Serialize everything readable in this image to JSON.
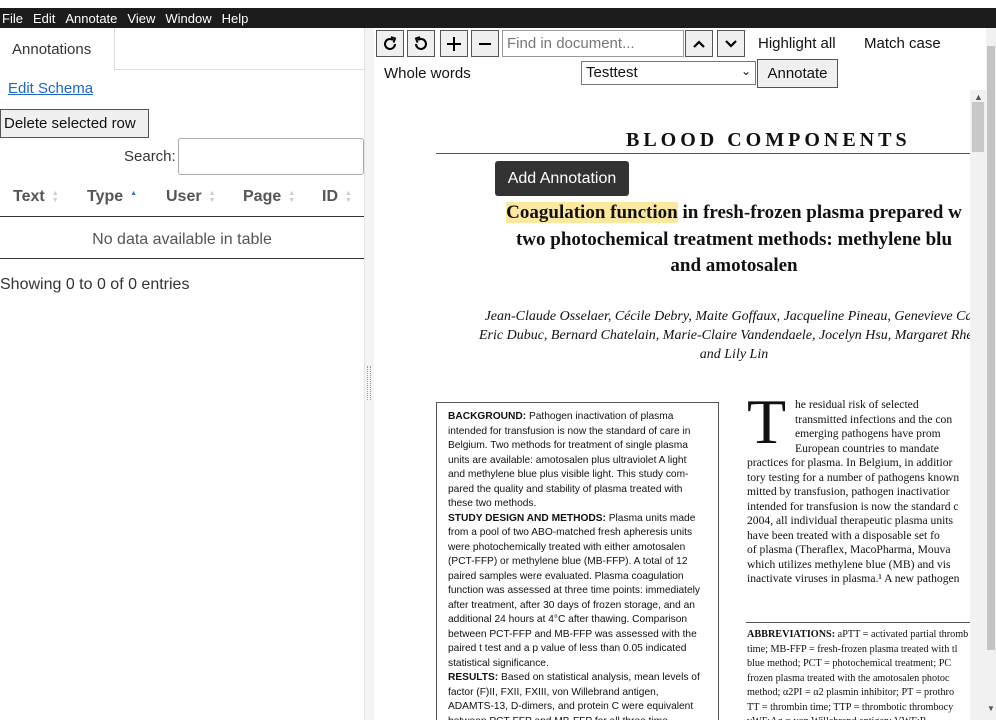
{
  "menu": [
    "File",
    "Edit",
    "Annotate",
    "View",
    "Window",
    "Help"
  ],
  "left": {
    "tab": "Annotations",
    "edit_schema": "Edit Schema",
    "delete_btn": "Delete selected row",
    "search_label": "Search:",
    "search_value": "",
    "columns": [
      "Text",
      "Type",
      "User",
      "Page",
      "ID"
    ],
    "sorted_column": "Type",
    "no_data": "No data available in table",
    "showing": "Showing 0 to 0 of 0 entries"
  },
  "toolbar": {
    "icons": [
      "redo-icon",
      "undo-icon",
      "zoom-in-icon",
      "zoom-out-icon",
      "find-previous-icon",
      "find-next-icon"
    ],
    "find_placeholder": "Find in document...",
    "highlight_all": "Highlight all",
    "match_case": "Match case",
    "whole_words": "Whole words",
    "schema_selected": "Testtest",
    "annotate": "Annotate"
  },
  "document": {
    "header": "BLOOD COMPONENTS",
    "add_annotation": "Add Annotation",
    "title_highlight": "Coagulation function",
    "title_line1_rest": " in fresh-frozen plasma prepared w",
    "title_line2": "two photochemical treatment methods: methylene blu",
    "title_line3": "and amotosalen",
    "authors": [
      "Jean-Claude Osselaer, Cécile Debry, Maite Goffaux, Jacqueline Pineau, Genevieve Calo",
      "Eric Dubuc, Bernard Chatelain, Marie-Claire Vandendaele, Jocelyn Hsu, Margaret Rheins",
      "and Lily Lin"
    ],
    "abstract": [
      {
        "h": "BACKGROUND:",
        "t": " Pathogen inactivation of plasma"
      },
      {
        "h": "",
        "t": "intended for transfusion is now the standard of care in"
      },
      {
        "h": "",
        "t": "Belgium. Two methods for treatment of single plasma"
      },
      {
        "h": "",
        "t": "units are available: amotosalen plus ultraviolet A light"
      },
      {
        "h": "",
        "t": "and methylene blue plus visible light. This study com-"
      },
      {
        "h": "",
        "t": "pared the quality and stability of plasma treated with"
      },
      {
        "h": "",
        "t": "these two methods."
      },
      {
        "h": "STUDY DESIGN AND METHODS:",
        "t": " Plasma units made"
      },
      {
        "h": "",
        "t": "from a pool of two ABO-matched fresh apheresis units"
      },
      {
        "h": "",
        "t": "were photochemically treated with either amotosalen"
      },
      {
        "h": "",
        "t": "(PCT-FFP) or methylene blue (MB-FFP). A total of 12"
      },
      {
        "h": "",
        "t": "paired samples were evaluated. Plasma coagulation"
      },
      {
        "h": "",
        "t": "function was assessed at three time points: immediately"
      },
      {
        "h": "",
        "t": "after treatment, after 30 days of frozen storage, and an"
      },
      {
        "h": "",
        "t": "additional 24 hours at 4°C after thawing. Comparison"
      },
      {
        "h": "",
        "t": "between PCT-FFP and MB-FFP was assessed with the"
      },
      {
        "h": "",
        "t": "paired t test and a p value of less than 0.05 indicated"
      },
      {
        "h": "",
        "t": "statistical significance."
      },
      {
        "h": "RESULTS:",
        "t": " Based on statistical analysis, mean levels of"
      },
      {
        "h": "",
        "t": "factor (F)II, FXII, FXIII, von Willebrand antigen,"
      },
      {
        "h": "",
        "t": "ADAMTS-13, D-dimers, and protein C were equivalent"
      },
      {
        "h": "",
        "t": "between PCT-FFP and MB-FFP for all three time"
      }
    ],
    "dropcap": "T",
    "body_indented": [
      "he  residual  risk  of  selected",
      "transmitted infections and the con",
      "emerging  pathogens  have  prom",
      "European  countries  to  mandate"
    ],
    "body": [
      "practices for plasma. In Belgium, in additior",
      "tory testing for a number of pathogens known",
      "mitted by transfusion, pathogen inactivatior",
      "intended for transfusion is now the standard c",
      "2004, all individual therapeutic plasma units",
      "have  been  treated  with  a  disposable  set  fo",
      "of  plasma  (Theraflex,  MacoPharma,  Mouva",
      "which  utilizes  methylene  blue  (MB)  and  vis",
      "inactivate viruses in plasma.¹ A new pathogen"
    ],
    "abbr_label": "ABBREVIATIONS:",
    "abbr": [
      " aPTT = activated partial thromb",
      "time; MB-FFP = fresh-frozen plasma treated with tl",
      "blue method; PCT = photochemical treatment; PC",
      "frozen plasma treated with the amotosalen photoc",
      "method; α2PI = α2 plasmin inhibitor; PT = prothro",
      "TT = thrombin time; TTP = thrombotic thrombocy",
      "                    vWF:Ag = von Willebrand antigen; VWF:R"
    ]
  }
}
